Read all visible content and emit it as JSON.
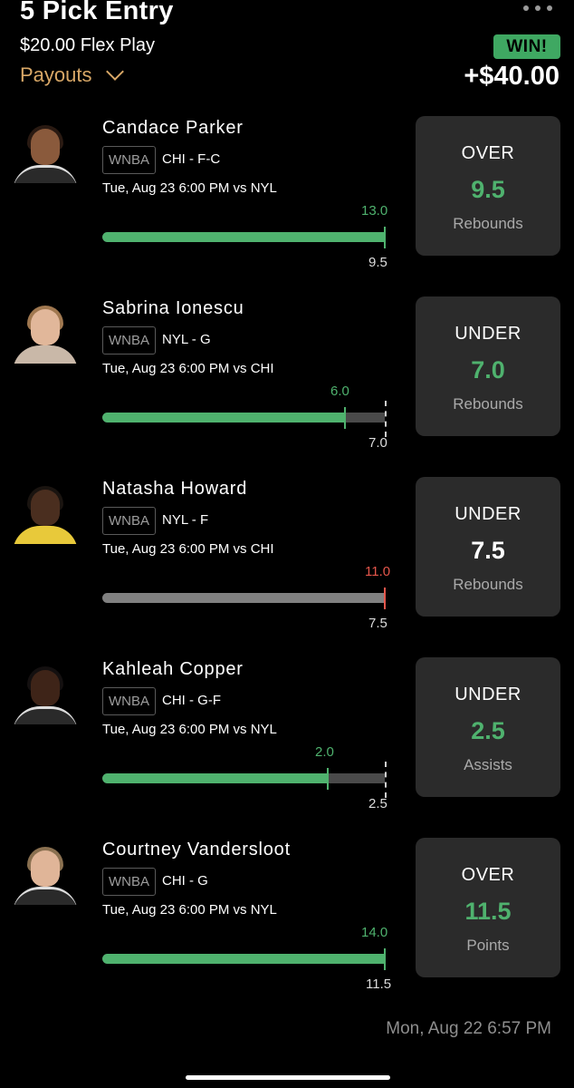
{
  "header": {
    "title": "5 Pick Entry",
    "play": "$20.00 Flex Play",
    "payouts": "Payouts",
    "status_badge": "WIN!",
    "winnings": "+$40.00"
  },
  "picks": [
    {
      "name": "Candace Parker",
      "league": "WNBA",
      "team": "CHI - F-C",
      "game": "Tue, Aug 23 6:00 PM  vs NYL",
      "actual": "13.0",
      "line_value": "9.5",
      "direction": "OVER",
      "line": "9.5",
      "stat": "Rebounds",
      "result": "hit",
      "progress_fraction": 1.0
    },
    {
      "name": "Sabrina Ionescu",
      "league": "WNBA",
      "team": "NYL - G",
      "game": "Tue, Aug 23 6:00 PM  vs CHI",
      "actual": "6.0",
      "line_value": "7.0",
      "direction": "UNDER",
      "line": "7.0",
      "stat": "Rebounds",
      "result": "hit",
      "progress_fraction": 0.857
    },
    {
      "name": "Natasha Howard",
      "league": "WNBA",
      "team": "NYL - F",
      "game": "Tue, Aug 23 6:00 PM  vs CHI",
      "actual": "11.0",
      "line_value": "7.5",
      "direction": "UNDER",
      "line": "7.5",
      "stat": "Rebounds",
      "result": "miss",
      "progress_fraction": 1.0
    },
    {
      "name": "Kahleah Copper",
      "league": "WNBA",
      "team": "CHI - G-F",
      "game": "Tue, Aug 23 6:00 PM  vs NYL",
      "actual": "2.0",
      "line_value": "2.5",
      "direction": "UNDER",
      "line": "2.5",
      "stat": "Assists",
      "result": "hit",
      "progress_fraction": 0.8
    },
    {
      "name": "Courtney Vandersloot",
      "league": "WNBA",
      "team": "CHI - G",
      "game": "Tue, Aug 23 6:00 PM  vs NYL",
      "actual": "14.0",
      "line_value": "11.5",
      "direction": "OVER",
      "line": "11.5",
      "stat": "Points",
      "result": "hit",
      "progress_fraction": 1.0
    }
  ],
  "footer": {
    "timestamp": "Mon, Aug 22 6:57 PM"
  },
  "colors": {
    "background": "#000000",
    "accent_green": "#4fb26e",
    "miss_red": "#e5564b",
    "card_bg": "#2b2b2b",
    "payouts_gold": "#d9a867",
    "track_gray": "#4a4a4a",
    "miss_bar_gray": "#808080"
  }
}
